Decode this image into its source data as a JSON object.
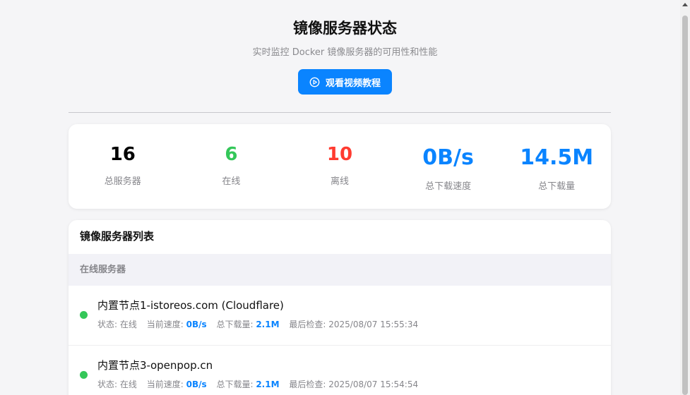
{
  "header": {
    "title": "镜像服务器状态",
    "subtitle": "实时监控 Docker 镜像服务器的可用性和性能",
    "tutorial_button": "观看视频教程"
  },
  "stats": [
    {
      "value": "16",
      "label": "总服务器",
      "color": "#000000"
    },
    {
      "value": "6",
      "label": "在线",
      "color": "#34c759"
    },
    {
      "value": "10",
      "label": "离线",
      "color": "#ff3b30"
    },
    {
      "value": "0B/s",
      "label": "总下载速度",
      "color": "#0a84ff"
    },
    {
      "value": "14.5M",
      "label": "总下载量",
      "color": "#0a84ff"
    }
  ],
  "server_list": {
    "title": "镜像服务器列表",
    "group_label": "在线服务器",
    "servers": [
      {
        "name": "内置节点1-istoreos.com (Cloudflare)",
        "status_label": "状态:",
        "status": "在线",
        "speed_label": "当前速度:",
        "speed": "0B/s",
        "download_label": "总下载量:",
        "download": "2.1M",
        "check_label": "最后检查:",
        "last_check": "2025/08/07 15:55:34"
      },
      {
        "name": "内置节点3-openpop.cn",
        "status_label": "状态:",
        "status": "在线",
        "speed_label": "当前速度:",
        "speed": "0B/s",
        "download_label": "总下载量:",
        "download": "2.1M",
        "check_label": "最后检查:",
        "last_check": "2025/08/07 15:54:54"
      }
    ]
  },
  "colors": {
    "accent": "#0a84ff",
    "online": "#34c759",
    "offline": "#ff3b30"
  }
}
